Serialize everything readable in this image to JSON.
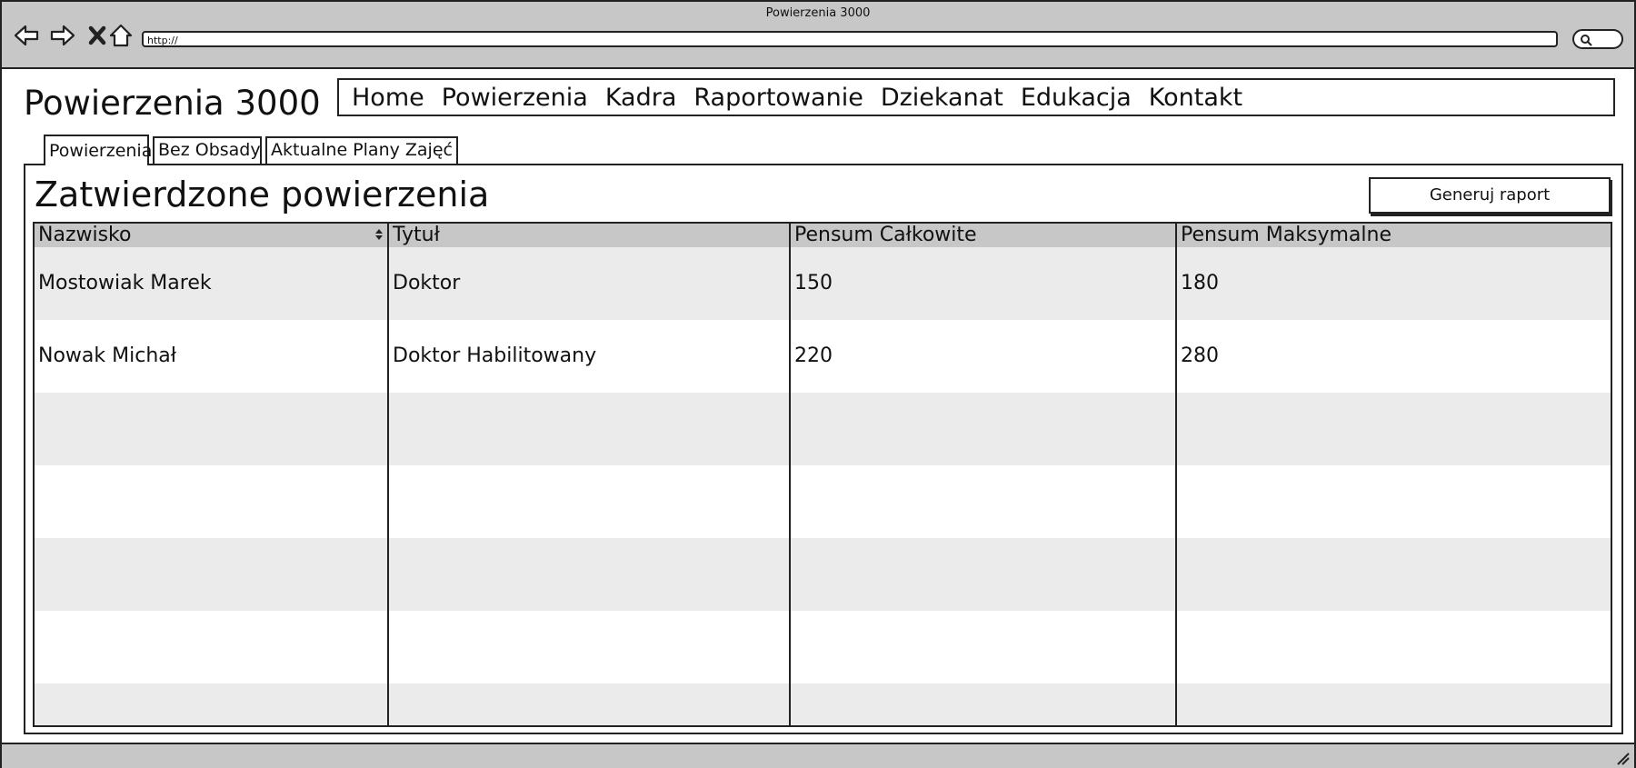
{
  "window": {
    "title": "Powierzenia 3000",
    "url": "http://"
  },
  "app": {
    "title": "Powierzenia 3000"
  },
  "menu": [
    "Home",
    "Powierzenia",
    "Kadra",
    "Raportowanie",
    "Dziekanat",
    "Edukacja",
    "Kontakt"
  ],
  "tabs": [
    "Powierzenia",
    "Bez Obsady",
    "Aktualne Plany Zajęć"
  ],
  "active_tab": "Powierzenia",
  "page": {
    "heading": "Zatwierdzone powierzenia",
    "report_button": "Generuj raport"
  },
  "table": {
    "headers": [
      "Nazwisko",
      "Tytuł",
      "Pensum Całkowite",
      "Pensum Maksymalne"
    ],
    "sorted_column": "Nazwisko",
    "rows": [
      [
        "Mostowiak Marek",
        "Doktor",
        "150",
        "180"
      ],
      [
        "Nowak Michał",
        "Doktor Habilitowany",
        "220",
        "280"
      ],
      [
        "",
        "",
        "",
        ""
      ],
      [
        "",
        "",
        "",
        ""
      ],
      [
        "",
        "",
        "",
        ""
      ],
      [
        "",
        "",
        "",
        ""
      ],
      [
        "",
        "",
        "",
        ""
      ]
    ],
    "row_colors": [
      "#ebebeb",
      "#ffffff"
    ]
  }
}
